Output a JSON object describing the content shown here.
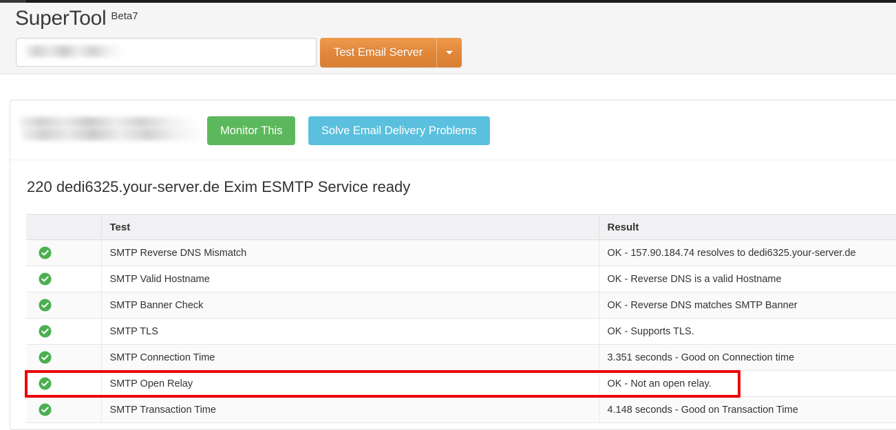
{
  "header": {
    "brand_title": "SuperTool",
    "brand_beta": "Beta7",
    "search": {
      "value": "",
      "placeholder": "",
      "redacted": true
    },
    "test_button_label": "Test Email Server",
    "dropdown_icon": "chevron-down-icon"
  },
  "actions": {
    "domain_redacted": true,
    "monitor_label": "Monitor This",
    "solve_label": "Solve Email Delivery Problems"
  },
  "banner": {
    "text": "220 dedi6325.your-server.de Exim ESMTP Service ready"
  },
  "table": {
    "columns": [
      "",
      "Test",
      "Result"
    ],
    "rows": [
      {
        "status": "ok",
        "status_icon": "green-check-icon",
        "test": "SMTP Reverse DNS Mismatch",
        "result": "OK - 157.90.184.74 resolves to dedi6325.your-server.de"
      },
      {
        "status": "ok",
        "status_icon": "green-check-icon",
        "test": "SMTP Valid Hostname",
        "result": "OK - Reverse DNS is a valid Hostname"
      },
      {
        "status": "ok",
        "status_icon": "green-check-icon",
        "test": "SMTP Banner Check",
        "result": "OK - Reverse DNS matches SMTP Banner"
      },
      {
        "status": "ok",
        "status_icon": "green-check-icon",
        "test": "SMTP TLS",
        "result": "OK - Supports TLS."
      },
      {
        "status": "ok",
        "status_icon": "green-check-icon",
        "test": "SMTP Connection Time",
        "result": "3.351 seconds - Good on Connection time"
      },
      {
        "status": "ok",
        "status_icon": "green-check-icon",
        "test": "SMTP Open Relay",
        "result": "OK - Not an open relay.",
        "highlighted": true
      },
      {
        "status": "ok",
        "status_icon": "green-check-icon",
        "test": "SMTP Transaction Time",
        "result": "4.148 seconds - Good on Transaction Time"
      }
    ]
  },
  "colors": {
    "accent_orange": "#e2873a",
    "success_green": "#5cb85c",
    "info_blue": "#5bc0de",
    "highlight_red": "#ee0000",
    "check_green": "#4caf50",
    "header_bg": "#f5f5f5"
  }
}
